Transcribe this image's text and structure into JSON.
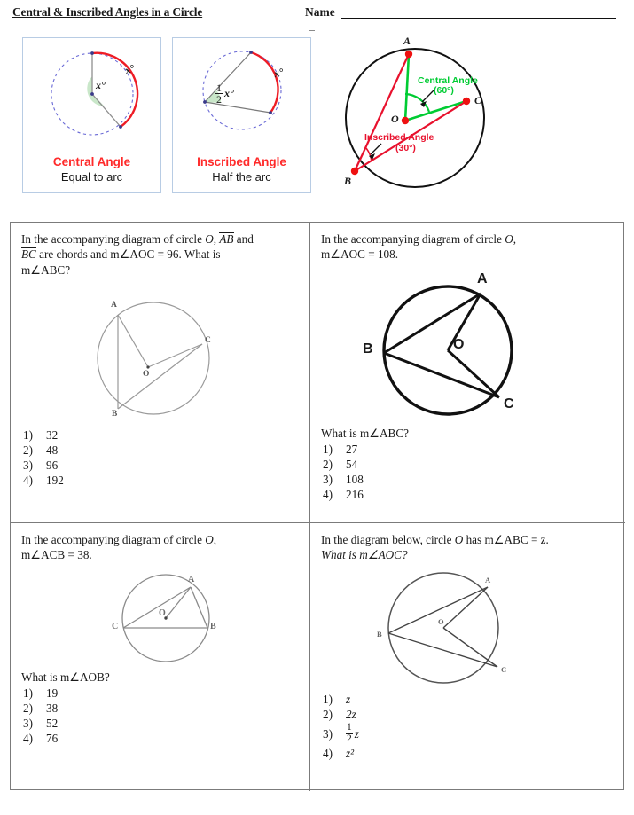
{
  "header": {
    "title": "Central & Inscribed Angles in a Circle",
    "name_label": "Name"
  },
  "info_panels": [
    {
      "id": "central",
      "title": "Central Angle",
      "subtitle": "Equal to arc",
      "angle_label": "x°",
      "arc_label": "x°",
      "arc_color": "#ee1c25",
      "circle_color": "#6a6ad6",
      "angle_fill": "#bfe3bf"
    },
    {
      "id": "inscribed",
      "title": "Inscribed Angle",
      "subtitle": "Half the arc",
      "angle_label_numerator": "1",
      "angle_label_denominator": "2",
      "angle_label_var": "x°",
      "arc_label": "x°",
      "arc_color": "#ee1c25",
      "circle_color": "#6a6ad6",
      "angle_fill": "#bfe3bf"
    }
  ],
  "reference_diagram": {
    "points": [
      "A",
      "B",
      "C",
      "O"
    ],
    "central_angle_label": "Central Angle",
    "central_angle_value": "(60°)",
    "central_angle_color": "#00cc33",
    "inscribed_angle_label": "Inscribed Angle",
    "inscribed_angle_value": "(30°)",
    "inscribed_angle_color": "#e8112d",
    "vertex_dot_color": "#ee1111",
    "circle_color": "#000000"
  },
  "questions": [
    {
      "id": "q1",
      "stem_line1_a": "In the accompanying diagram of circle ",
      "stem_circle": "O",
      "stem_line1_b": ", ",
      "chord1": "AB",
      "stem_line1_c": " and",
      "chord2": "BC",
      "stem_line2": " are chords and m∠AOC = 96.  What is",
      "stem_line3": "m∠ABC?",
      "choices": [
        "32",
        "48",
        "96",
        "192"
      ],
      "choice_numbers": [
        "1)",
        "2)",
        "3)",
        "4)"
      ],
      "figure_labels": [
        "A",
        "B",
        "C",
        "O"
      ]
    },
    {
      "id": "q2",
      "stem_line1": "In the accompanying diagram of circle ",
      "stem_circle": "O",
      "stem_line1_end": ",",
      "stem_line2": "m∠AOC = 108.",
      "prompt": "What is m∠ABC?",
      "choices": [
        "27",
        "54",
        "108",
        "216"
      ],
      "choice_numbers": [
        "1)",
        "2)",
        "3)",
        "4)"
      ],
      "figure_labels": [
        "A",
        "B",
        "C",
        "O"
      ]
    },
    {
      "id": "q3",
      "stem_line1": "In the accompanying diagram of circle ",
      "stem_circle": "O",
      "stem_line1_end": ",",
      "stem_line2": "m∠ACB = 38.",
      "prompt": "What is m∠AOB?",
      "choices": [
        "19",
        "38",
        "52",
        "76"
      ],
      "choice_numbers": [
        "1)",
        "2)",
        "3)",
        "4)"
      ],
      "figure_labels": [
        "A",
        "B",
        "C",
        "O"
      ]
    },
    {
      "id": "q4",
      "stem_line1": "In the diagram below, circle ",
      "stem_circle": "O",
      "stem_line1_end": " has m∠ABC = z.",
      "stem_line2": "What is m∠AOC?",
      "choices": [
        "z",
        "2z",
        "frac_half_z",
        "z²"
      ],
      "choice_numbers": [
        "1)",
        "2)",
        "3)",
        "4)"
      ],
      "fraction_numerator": "1",
      "fraction_denominator": "2",
      "fraction_var": "z",
      "figure_labels": [
        "A",
        "B",
        "C",
        "O"
      ]
    }
  ]
}
